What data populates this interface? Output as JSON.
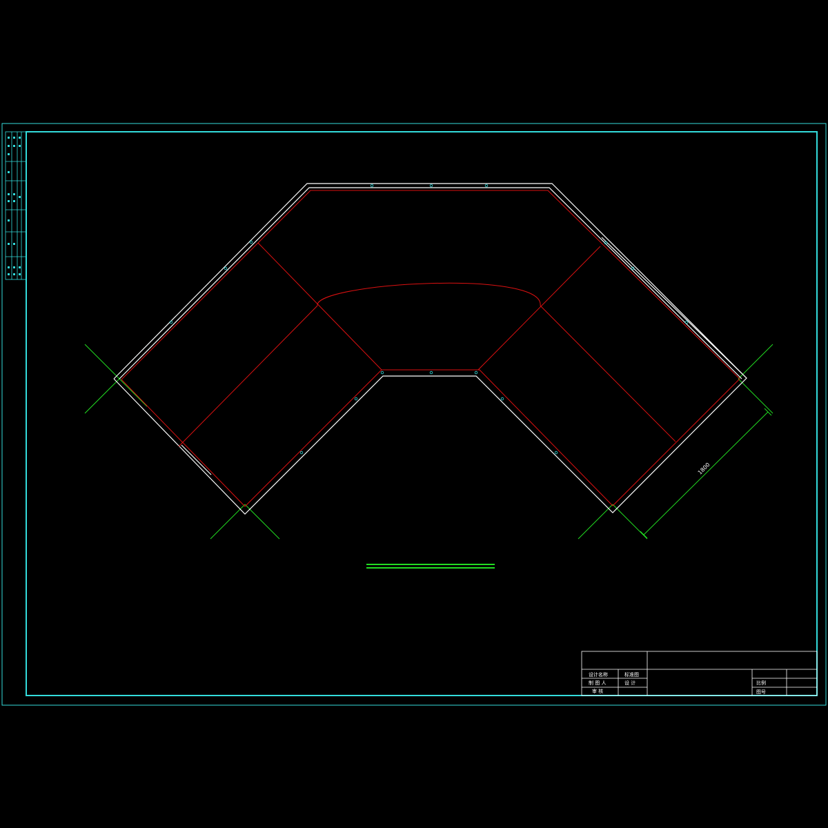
{
  "colors": {
    "background": "#000000",
    "frame": "#33dddd",
    "outline": "#ffffff",
    "inner": "#dd1111",
    "dimension": "#22dd22",
    "marker": "#33dddd"
  },
  "dimension": {
    "label": "1800"
  },
  "title_block": {
    "project_label": "设计名称",
    "project_value": "标准图",
    "drawn_label": "制 图 人",
    "drawn_value": "设 计",
    "checked_label": "审 核",
    "scale_label": "比例",
    "sheet_label": "图号"
  }
}
